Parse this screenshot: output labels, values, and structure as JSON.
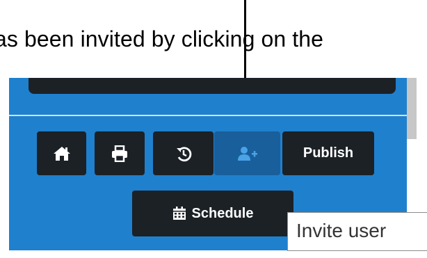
{
  "doc": {
    "caption": "as been invited by clicking on the"
  },
  "toolbar": {
    "home_icon": "home-icon",
    "print_icon": "print-icon",
    "history_icon": "history-icon",
    "invite_icon": "user-plus-icon",
    "publish_label": "Publish",
    "schedule_label": "Schedule",
    "schedule_icon": "calendar-icon"
  },
  "tooltip": {
    "text": "Invite user"
  },
  "colors": {
    "panel": "#1f80ce",
    "button": "#1c2126",
    "button_active": "#195f9b"
  }
}
